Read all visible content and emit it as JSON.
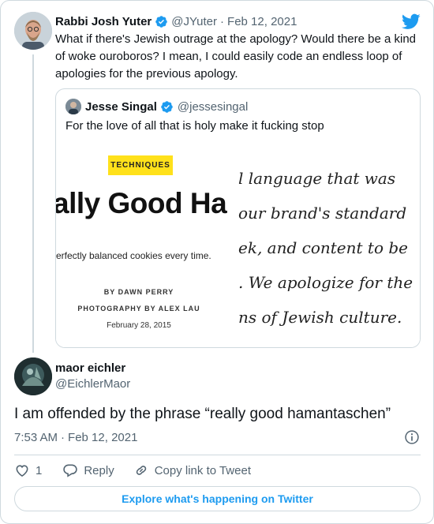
{
  "parent_tweet": {
    "name": "Rabbi Josh Yuter",
    "handle": "@JYuter",
    "separator": "·",
    "date": "Feb 12, 2021",
    "text": "What if there's Jewish outrage at the apology? Would there be a kind of woke ouroboros? I mean, I could easily code an endless loop of apologies for the previous apology."
  },
  "quoted_tweet": {
    "name": "Jesse Singal",
    "handle": "@jessesingal",
    "text": "For the love of all that is holy make it fucking stop",
    "media": {
      "left": {
        "badge": "TECHNIQUES",
        "headline": "ally Good Ha",
        "subline": "erfectly balanced cookies every time.",
        "byline": "BY DAWN PERRY",
        "photo_credit": "PHOTOGRAPHY BY ALEX LAU",
        "date": "February 28, 2015"
      },
      "right": {
        "lines": [
          "l language that was",
          "our brand's standard",
          "ek, and content to be",
          ". We apologize for the",
          "ns of Jewish culture."
        ]
      }
    }
  },
  "reply_tweet": {
    "name": "maor eichler",
    "handle": "@EichlerMaor",
    "text": "I am offended by the phrase “really good hamantaschen”",
    "time": "7:53 AM",
    "separator": "·",
    "date": "Feb 12, 2021"
  },
  "actions": {
    "like_count": "1",
    "reply_label": "Reply",
    "copy_link_label": "Copy link to Tweet"
  },
  "explore_label": "Explore what's happening on Twitter",
  "icons": {
    "verified": "verified-badge-icon",
    "twitter": "twitter-bird-icon",
    "info": "info-icon",
    "like": "heart-icon",
    "reply": "reply-bubble-icon",
    "link": "link-icon"
  },
  "colors": {
    "brand": "#1d9bf0",
    "badge_yellow": "#ffe11b",
    "secondary_text": "#536471",
    "border": "#cfd9de"
  }
}
